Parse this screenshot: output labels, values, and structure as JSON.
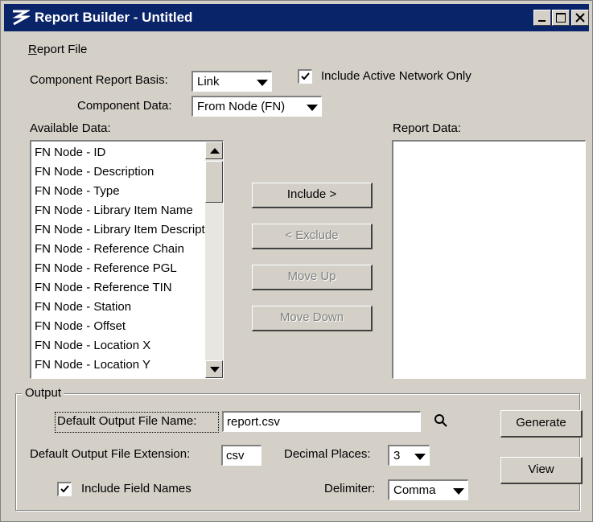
{
  "window": {
    "title": "Report Builder - Untitled"
  },
  "menu": {
    "items": [
      {
        "label": "Report File",
        "accel": "R",
        "rest": "eport File"
      }
    ]
  },
  "component": {
    "basis_label": "Component Report Basis:",
    "basis_value": "Link",
    "active_only_label": "Include Active Network Only",
    "active_only_checked": true,
    "data_label": "Component Data:",
    "data_value": "From Node (FN)"
  },
  "available": {
    "label": "Available Data:",
    "items": [
      "FN Node - ID",
      "FN Node - Description",
      "FN Node - Type",
      "FN Node - Library Item Name",
      "FN Node - Library Item Description",
      "FN Node - Reference Chain",
      "FN Node - Reference PGL",
      "FN Node - Reference TIN",
      "FN Node - Station",
      "FN Node - Offset",
      "FN Node - Location X",
      "FN Node - Location Y"
    ]
  },
  "report": {
    "label": "Report Data:",
    "items": []
  },
  "buttons": {
    "include": "Include >",
    "exclude": "< Exclude",
    "move_up": "Move Up",
    "move_down": "Move Down",
    "generate": "Generate",
    "view": "View"
  },
  "output": {
    "group_label": "Output",
    "file_name_label": "Default Output File Name:",
    "file_name_value": "report.csv",
    "extension_label": "Default Output File Extension:",
    "extension_value": "csv",
    "decimal_label": "Decimal Places:",
    "decimal_value": "3",
    "include_field_names_label": "Include Field Names",
    "include_field_names_checked": true,
    "delimiter_label": "Delimiter:",
    "delimiter_value": "Comma"
  },
  "colors": {
    "titlebar": "#0a246a",
    "face": "#d4d0c8"
  }
}
